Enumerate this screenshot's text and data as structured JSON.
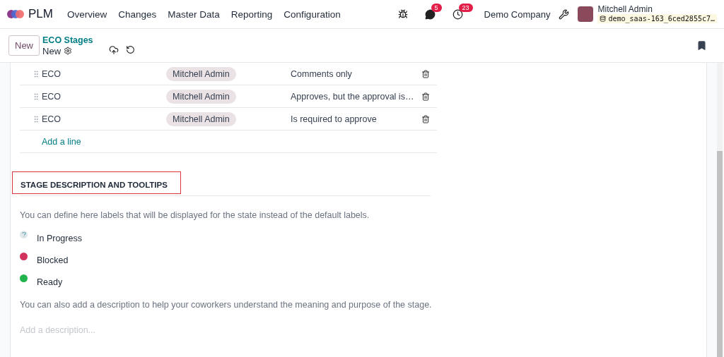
{
  "navbar": {
    "app": "PLM",
    "menu": [
      "Overview",
      "Changes",
      "Master Data",
      "Reporting",
      "Configuration"
    ],
    "messages_badge": "5",
    "activities_badge": "23",
    "company": "Demo Company",
    "user": "Mitchell Admin",
    "database": "demo_saas-163_6ced2855c7…"
  },
  "control_panel": {
    "new_button": "New",
    "breadcrumb": "ECO Stages",
    "record": "New"
  },
  "approvals": {
    "rows": [
      {
        "stage": "ECO",
        "user": "Mitchell Admin",
        "approval": "Comments only"
      },
      {
        "stage": "ECO",
        "user": "Mitchell Admin",
        "approval": "Approves, but the approval is…"
      },
      {
        "stage": "ECO",
        "user": "Mitchell Admin",
        "approval": "Is required to approve"
      }
    ],
    "add_line": "Add a line"
  },
  "section": {
    "title": "STAGE DESCRIPTION AND TOOLTIPS",
    "intro": "You can define here labels that will be displayed for the state instead of the default labels.",
    "states": [
      {
        "kind": "unknown",
        "label": "In Progress",
        "color": "#dfe7ea"
      },
      {
        "kind": "dot",
        "label": "Blocked",
        "color": "#d2335d"
      },
      {
        "kind": "dot",
        "label": "Ready",
        "color": "#21b34c"
      }
    ],
    "hint": "You can also add a description to help your coworkers understand the meaning and purpose of the stage.",
    "description": {
      "placeholder": "Add a description..."
    }
  }
}
